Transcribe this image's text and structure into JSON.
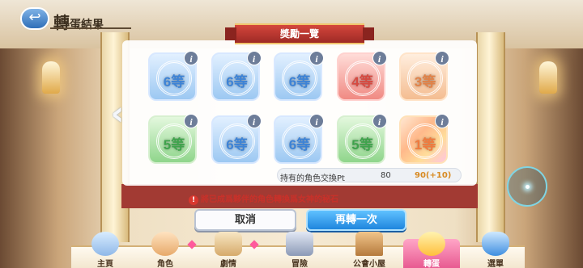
{
  "header": {
    "back_label": "↩",
    "title_big": "轉",
    "title_rest": "蛋結果"
  },
  "panel": {
    "ribbon_title": "獎勵一覽",
    "prev_arrow": "‹",
    "items": [
      {
        "rank": "6等",
        "color": "blue"
      },
      {
        "rank": "6等",
        "color": "blue"
      },
      {
        "rank": "6等",
        "color": "blue"
      },
      {
        "rank": "4等",
        "color": "red"
      },
      {
        "rank": "3等",
        "color": "peach"
      },
      {
        "rank": "5等",
        "color": "green"
      },
      {
        "rank": "6等",
        "color": "blue"
      },
      {
        "rank": "6等",
        "color": "blue"
      },
      {
        "rank": "5等",
        "color": "green"
      },
      {
        "rank": "1等",
        "color": "gold"
      }
    ],
    "info_glyph": "i",
    "pt_label": "持有的角色交換Pt",
    "pt_current": "80",
    "pt_next": "90(+10)"
  },
  "warning": {
    "icon": "!",
    "text": "將已成爲夥伴的角色轉換爲女神的秘石"
  },
  "buttons": {
    "cancel": "取消",
    "again": "再轉一次"
  },
  "nav": {
    "items": [
      {
        "label": "主頁",
        "icon": "castle-icon"
      },
      {
        "label": "角色",
        "icon": "character-icon"
      },
      {
        "label": "劇情",
        "icon": "scroll-icon"
      },
      {
        "label": "冒險",
        "icon": "sword-shield-icon"
      },
      {
        "label": "公會小屋",
        "icon": "guild-house-icon"
      },
      {
        "label": "轉蛋",
        "icon": "gacha-icon",
        "active": true
      },
      {
        "label": "選單",
        "icon": "menu-crystal-icon"
      }
    ]
  },
  "colors": {
    "accent_blue": "#1f86de",
    "ribbon_red": "#b3332c",
    "warning_red": "#c8312a",
    "pt_next": "#d88a22"
  }
}
